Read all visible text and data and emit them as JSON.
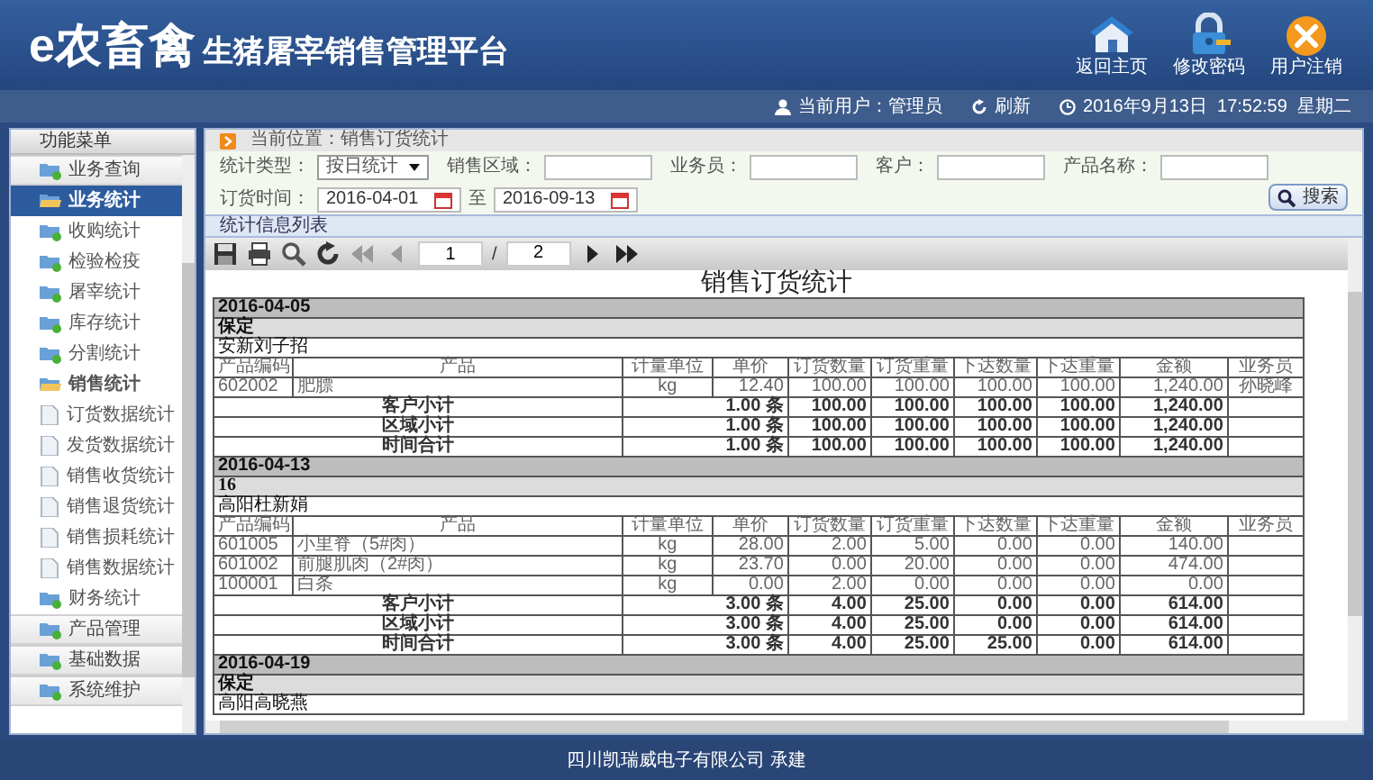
{
  "header": {
    "logo_mark": "e农畜禽",
    "title": "生猪屠宰销售管理平台",
    "actions": [
      {
        "kind": "home",
        "label": "返回主页"
      },
      {
        "kind": "password",
        "label": "修改密码"
      },
      {
        "kind": "logout",
        "label": "用户注销"
      }
    ]
  },
  "info_bar": {
    "user": "当前用户：管理员",
    "refresh": "刷新",
    "datetime": "2016年9月13日  17:52:59  星期二"
  },
  "sidebar": {
    "title": "功能菜单",
    "items": [
      {
        "label": "业务查询",
        "selected": false,
        "expanded": false
      },
      {
        "label": "业务统计",
        "selected": true,
        "expanded": true,
        "children": [
          {
            "label": "收购统计",
            "selected": false
          },
          {
            "label": "检验检疫",
            "selected": false
          },
          {
            "label": "屠宰统计",
            "selected": false
          },
          {
            "label": "库存统计",
            "selected": false
          },
          {
            "label": "分割统计",
            "selected": false
          },
          {
            "label": "销售统计",
            "selected": false,
            "expanded": true,
            "children": [
              {
                "label": "订货数据统计",
                "selected": false
              },
              {
                "label": "发货数据统计",
                "selected": false
              },
              {
                "label": "销售收货统计",
                "selected": false
              },
              {
                "label": "销售退货统计",
                "selected": false
              },
              {
                "label": "销售损耗统计",
                "selected": false
              },
              {
                "label": "销售数据统计",
                "selected": false
              }
            ]
          },
          {
            "label": "财务统计",
            "selected": false
          }
        ]
      },
      {
        "label": "产品管理",
        "selected": false,
        "expanded": false
      },
      {
        "label": "基础数据",
        "selected": false,
        "expanded": false
      },
      {
        "label": "系统维护",
        "selected": false,
        "expanded": false
      }
    ]
  },
  "breadcrumb": "当前位置：销售订货统计",
  "filters": {
    "type_label": "统计类型：",
    "type_value": "按日统计",
    "region_label": "销售区域：",
    "salesman_label": "业务员：",
    "customer_label": "客户：",
    "product_label": "产品名称：",
    "date_label": "订货时间：",
    "date_from": "2016-04-01",
    "date_sep": "至",
    "date_to": "2016-09-13",
    "search_button": "搜索"
  },
  "section_title": "统计信息列表",
  "pager": {
    "page": "1",
    "sep": "/",
    "total": "2"
  },
  "report": {
    "title": "销售订货统计",
    "rows": [
      {
        "kind": "date",
        "text": "2016-04-05"
      },
      {
        "kind": "region",
        "text": "保定"
      },
      {
        "kind": "customer",
        "text": "安新刘子招"
      },
      {
        "kind": "header",
        "columns": [
          "产品编码",
          "产品",
          "计量单位",
          "单价",
          "订货数量",
          "订货重量",
          "下达数量",
          "下达重量",
          "金额",
          "业务员"
        ]
      },
      {
        "kind": "item",
        "code": "602002",
        "product": "肥膘",
        "unit": "kg",
        "price": "12.40",
        "values": [
          "100.00",
          "100.00",
          "100.00",
          "100.00",
          "1,240.00"
        ],
        "salesman": "孙晓峰"
      },
      {
        "kind": "subtotal",
        "label": "客户小计",
        "count": "1.00 条",
        "values": [
          "100.00",
          "100.00",
          "100.00",
          "100.00",
          "1,240.00"
        ]
      },
      {
        "kind": "subtotal",
        "label": "区域小计",
        "count": "1.00 条",
        "values": [
          "100.00",
          "100.00",
          "100.00",
          "100.00",
          "1,240.00"
        ]
      },
      {
        "kind": "subtotal",
        "label": "时间合计",
        "count": "1.00 条",
        "values": [
          "100.00",
          "100.00",
          "100.00",
          "100.00",
          "1,240.00"
        ]
      },
      {
        "kind": "date",
        "text": "2016-04-13"
      },
      {
        "kind": "region",
        "text": "16"
      },
      {
        "kind": "customer",
        "text": "高阳杜新娟"
      },
      {
        "kind": "header",
        "columns": [
          "产品编码",
          "产品",
          "计量单位",
          "单价",
          "订货数量",
          "订货重量",
          "下达数量",
          "下达重量",
          "金额",
          "业务员"
        ]
      },
      {
        "kind": "item",
        "code": "601005",
        "product": "小里脊（5#肉）",
        "unit": "kg",
        "price": "28.00",
        "values": [
          "2.00",
          "5.00",
          "0.00",
          "0.00",
          "140.00"
        ]
      },
      {
        "kind": "item",
        "code": "601002",
        "product": "前腿肌肉（2#肉）",
        "unit": "kg",
        "price": "23.70",
        "values": [
          "0.00",
          "20.00",
          "0.00",
          "0.00",
          "474.00"
        ]
      },
      {
        "kind": "item",
        "code": "100001",
        "product": "白条",
        "unit": "kg",
        "price": "0.00",
        "values": [
          "2.00",
          "0.00",
          "0.00",
          "0.00",
          "0.00"
        ]
      },
      {
        "kind": "subtotal",
        "label": "客户小计",
        "count": "3.00 条",
        "values": [
          "4.00",
          "25.00",
          "0.00",
          "0.00",
          "614.00"
        ]
      },
      {
        "kind": "subtotal",
        "label": "区域小计",
        "count": "3.00 条",
        "values": [
          "4.00",
          "25.00",
          "0.00",
          "0.00",
          "614.00"
        ]
      },
      {
        "kind": "subtotal",
        "label": "时间合计",
        "count": "3.00 条",
        "values": [
          "4.00",
          "25.00",
          "25.00",
          "0.00",
          "614.00"
        ]
      },
      {
        "kind": "date",
        "text": "2016-04-19"
      },
      {
        "kind": "region",
        "text": "保定"
      },
      {
        "kind": "customer",
        "text": "高阳高晓燕"
      }
    ]
  },
  "footer": "四川凯瑞威电子有限公司 承建"
}
